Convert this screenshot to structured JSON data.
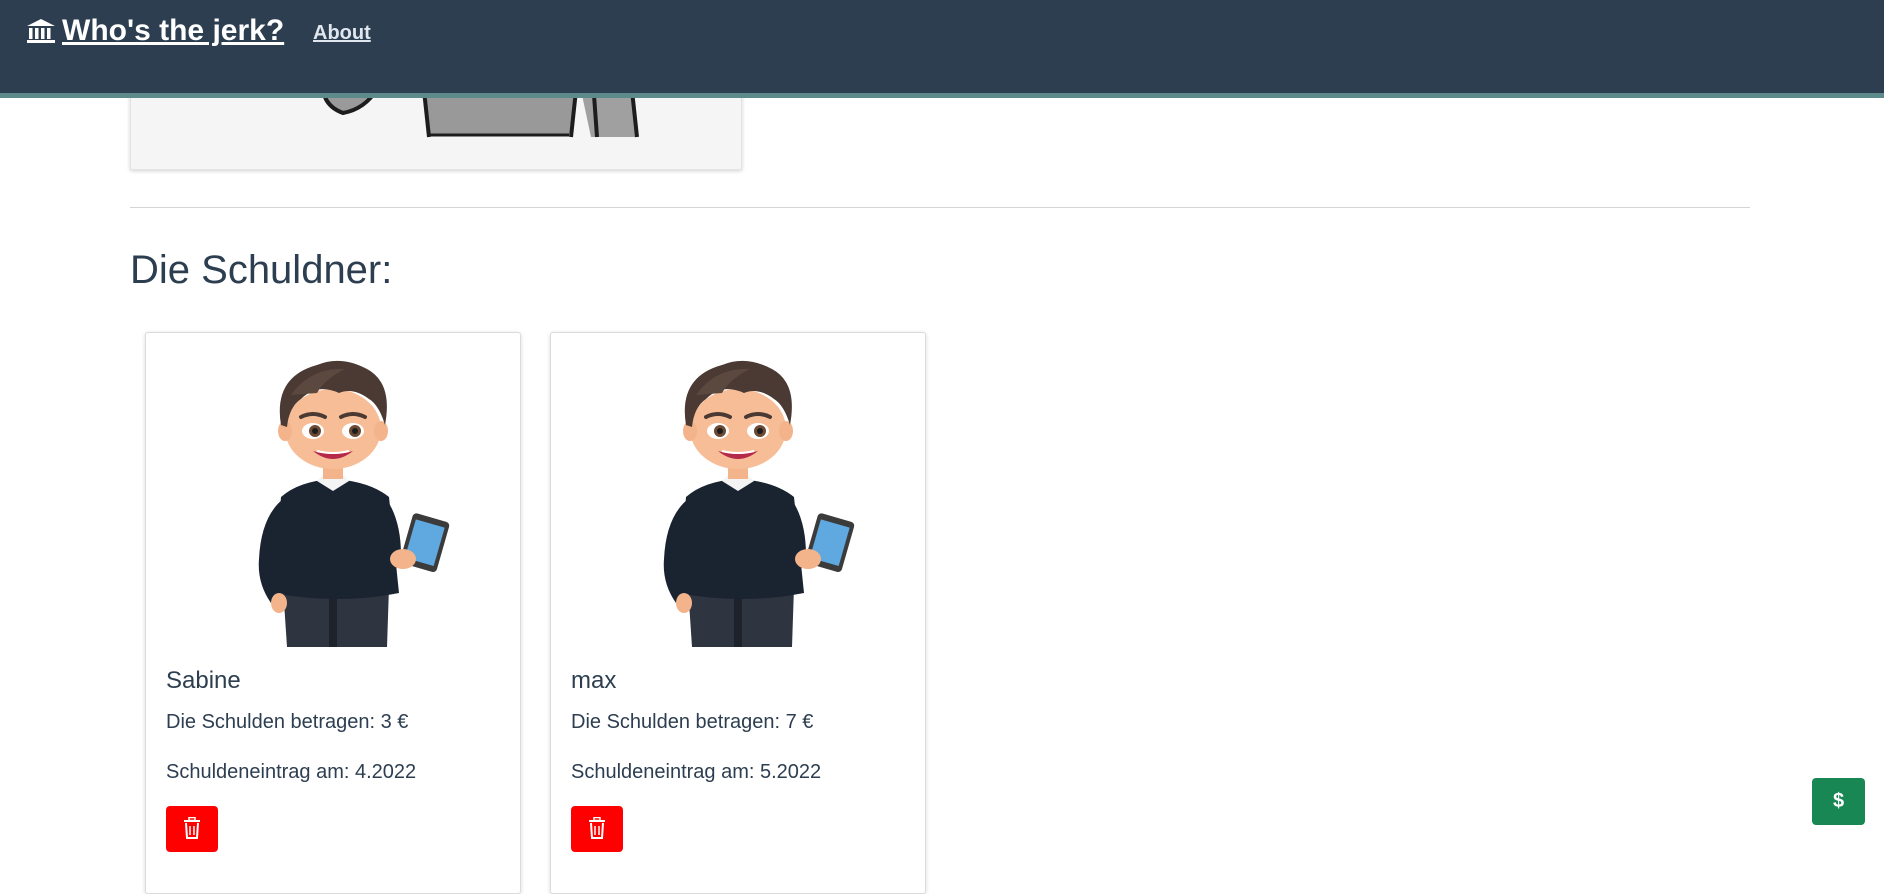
{
  "navbar": {
    "brand_icon": "bank-icon",
    "brand_label": "Who's the jerk?",
    "about_label": "About"
  },
  "main": {
    "section_title": "Die Schuldner:",
    "debtors": [
      {
        "name": "Sabine",
        "debt_text": "Die Schulden betragen: 3 €",
        "date_text": "Schuldeneintrag am: 4.2022",
        "avatar_icon": "cartoon-man-avatar",
        "delete_icon": "trash-icon"
      },
      {
        "name": "max",
        "debt_text": "Die Schulden betragen: 7 €",
        "date_text": "Schuldeneintrag am: 5.2022",
        "avatar_icon": "cartoon-man-avatar",
        "delete_icon": "trash-icon"
      }
    ]
  },
  "floating": {
    "add_debt_label": "$"
  },
  "colors": {
    "navbar_bg": "#2c3e50",
    "navbar_border": "#5d8a8a",
    "delete_button": "#ff0000",
    "floating_button": "#198754"
  }
}
